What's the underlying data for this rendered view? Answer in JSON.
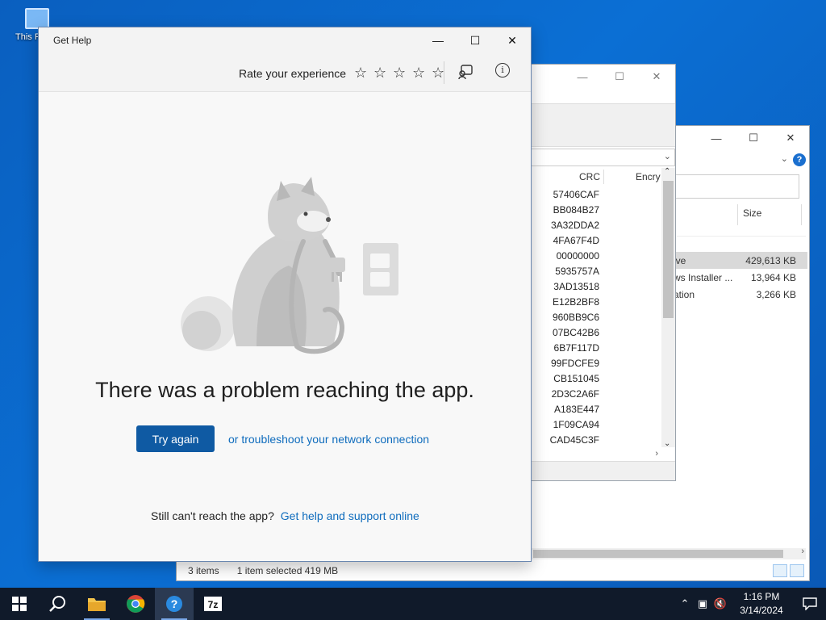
{
  "desktop": {
    "icon_label": "This PC"
  },
  "explorer": {
    "size_header": "Size",
    "rows": [
      {
        "name": "ive",
        "size": "429,613 KB",
        "selected": true
      },
      {
        "name": "ws Installer ...",
        "size": "13,964 KB",
        "selected": false
      },
      {
        "name": "ation",
        "size": "3,266 KB",
        "selected": false
      }
    ],
    "status": {
      "items": "3 items",
      "selected": "1 item selected  419 MB"
    }
  },
  "sevenzip": {
    "headers": {
      "crc": "CRC",
      "encrypted": "Encry"
    },
    "crcs": [
      "57406CAF",
      "BB084B27",
      "3A32DDA2",
      "4FA67F4D",
      "00000000",
      "5935757A",
      "3AD13518",
      "E12B2BF8",
      "960BB9C6",
      "07BC42B6",
      "6B7F117D",
      "99FDCFE9",
      "CB151045",
      "2D3C2A6F",
      "A183E447",
      "1F09CA94",
      "CAD45C3F"
    ]
  },
  "gethelp": {
    "title": "Get Help",
    "rate_label": "Rate your experience",
    "stars": 5,
    "message": "There was a problem reaching the app.",
    "try_again": "Try again",
    "troubleshoot_link": "or troubleshoot your network connection",
    "still_text": "Still can't reach the app?",
    "support_link": "Get help and support online"
  },
  "taskbar": {
    "time": "1:16 PM",
    "date": "3/14/2024",
    "apps": [
      "start-icon",
      "search-icon",
      "file-explorer-icon",
      "chrome-icon",
      "get-help-icon",
      "7zip-icon"
    ]
  }
}
